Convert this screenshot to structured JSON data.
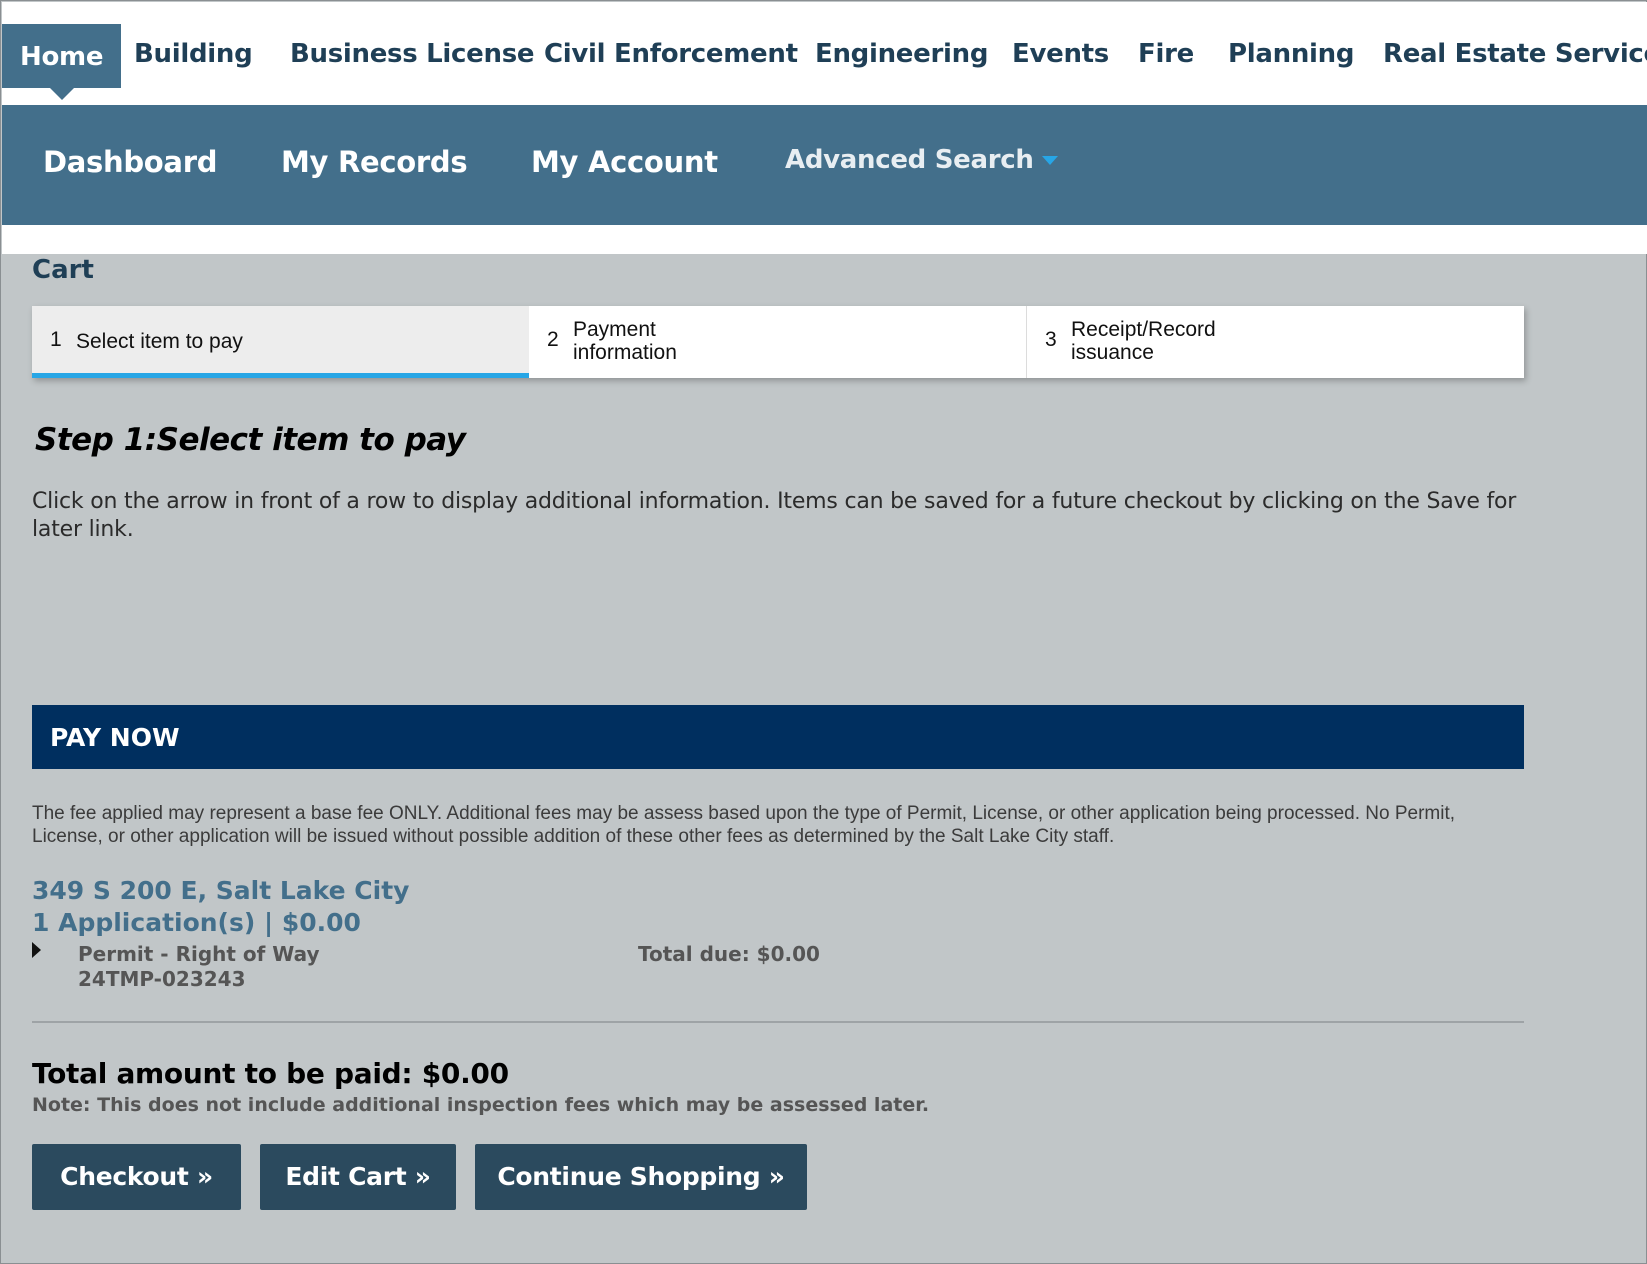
{
  "top_nav": {
    "items": [
      "Home",
      "Building",
      "Business License",
      "Civil Enforcement",
      "Engineering",
      "Events",
      "Fire",
      "Planning",
      "Real Estate Services"
    ],
    "active": "Home"
  },
  "sub_nav": {
    "dashboard": "Dashboard",
    "my_records": "My Records",
    "my_account": "My Account",
    "advanced_search": "Advanced Search"
  },
  "cart": {
    "title": "Cart",
    "steps": [
      {
        "num": "1",
        "label": "Select item to pay"
      },
      {
        "num": "2",
        "label": "Payment information"
      },
      {
        "num": "3",
        "label": "Receipt/Record issuance"
      }
    ],
    "step_heading": "Step 1:Select item to pay",
    "instructions": "Click on the arrow in front of a row to display additional information. Items can be saved for a future checkout by clicking on the Save for later link."
  },
  "pay_now": {
    "title": "PAY NOW",
    "disclaimer": "The fee applied may represent a base fee ONLY. Additional fees may be assess based upon the type of Permit, License, or other application being processed. No Permit, License, or other application will be issued without possible addition of these other fees as determined by the Salt Lake City staff.",
    "address": "349 S 200 E, Salt Lake City",
    "applications": "1 Application(s) | $0.00",
    "item": {
      "type": "Permit - Right of Way",
      "id": "24TMP-023243",
      "total_due": "Total due: $0.00"
    }
  },
  "totals": {
    "total_amount": "Total amount to be paid: $0.00",
    "note": "Note: This does not include additional inspection fees which may be assessed later."
  },
  "buttons": {
    "checkout": "Checkout »",
    "edit_cart": "Edit Cart »",
    "continue_shopping": "Continue Shopping »"
  },
  "colors": {
    "nav_blue": "#436f8b",
    "pay_now_bar": "#002f5f",
    "button": "#2b4a5e",
    "step_active_underline": "#27a6e6",
    "page_background": "#c1c6c8"
  }
}
